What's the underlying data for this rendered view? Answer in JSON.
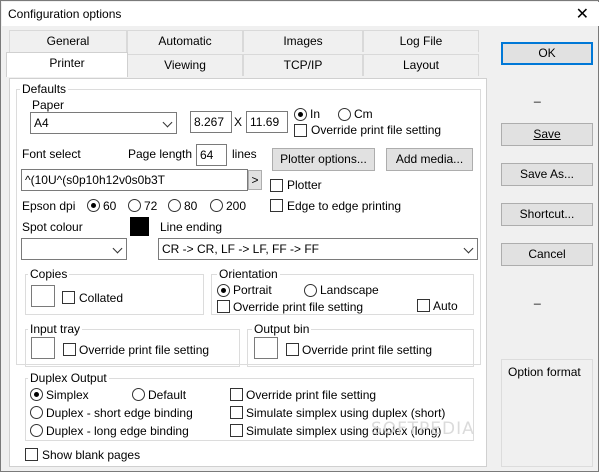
{
  "window": {
    "title": "Configuration options",
    "close_glyph": "✕"
  },
  "tabs_row1": [
    "General",
    "Automatic",
    "Images",
    "Log File"
  ],
  "tabs_row2": [
    "Printer",
    "Viewing",
    "TCP/IP",
    "Layout"
  ],
  "selected_tab": "Printer",
  "defaults": {
    "label": "Defaults",
    "paper": {
      "label": "Paper",
      "value": "A4",
      "width": "8.267",
      "x_label": "X",
      "height": "11.69",
      "unit_in": "In",
      "unit_cm": "Cm",
      "override": "Override print file setting"
    },
    "font": {
      "label": "Font select",
      "value": "^(10U^(s0p10h12v0s0b3T",
      "more": ">"
    },
    "page_length": {
      "label": "Page length",
      "value": "64",
      "unit": "lines"
    },
    "plotter_options": "Plotter options...",
    "add_media": "Add media...",
    "plotter": "Plotter",
    "epson": {
      "label": "Epson dpi",
      "options": [
        "60",
        "72",
        "80",
        "200"
      ],
      "selected": "60"
    },
    "edge_to_edge": "Edge to edge printing",
    "spot_colour": {
      "label": "Spot colour",
      "value": "",
      "swatch": "#000000"
    },
    "line_ending": {
      "label": "Line ending",
      "value": "CR -> CR, LF -> LF, FF -> FF"
    },
    "copies": {
      "label": "Copies",
      "value": "",
      "collated": "Collated"
    },
    "orientation": {
      "label": "Orientation",
      "portrait": "Portrait",
      "landscape": "Landscape",
      "override": "Override print file setting",
      "auto": "Auto"
    },
    "input_tray": {
      "label": "Input tray",
      "value": "",
      "override": "Override print file setting"
    },
    "output_bin": {
      "label": "Output bin",
      "value": "",
      "override": "Override print file setting"
    }
  },
  "duplex": {
    "label": "Duplex Output",
    "simplex": "Simplex",
    "default": "Default",
    "short": "Duplex - short edge binding",
    "long": "Duplex - long edge binding",
    "override": "Override print file setting",
    "sim_short": "Simulate simplex using duplex (short)",
    "sim_long": "Simulate simplex using duplex (long)"
  },
  "show_blank": "Show blank pages",
  "side": {
    "ok": "OK",
    "dash1": "_",
    "save": "Save",
    "save_as": "Save As...",
    "shortcut": "Shortcut...",
    "cancel": "Cancel",
    "dash2": "_",
    "option_format": "Option format"
  },
  "watermark": "SOFTPEDIA"
}
